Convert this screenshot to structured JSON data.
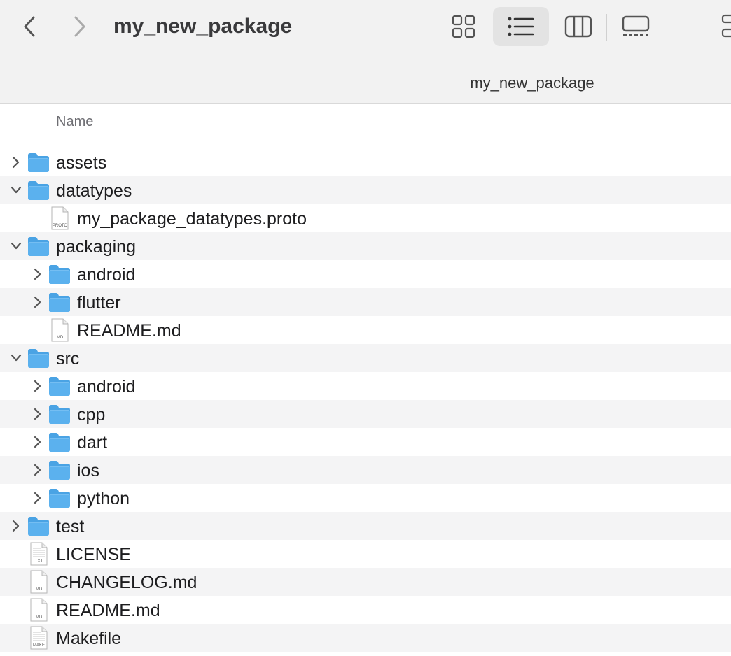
{
  "window": {
    "title": "my_new_package",
    "path_label": "my_new_package"
  },
  "toolbar": {
    "back_icon": "chevron-left-icon",
    "forward_icon": "chevron-right-icon",
    "views": [
      {
        "name": "icon-view",
        "icon": "grid-icon",
        "active": false
      },
      {
        "name": "list-view",
        "icon": "list-icon",
        "active": true
      },
      {
        "name": "column-view",
        "icon": "columns-icon",
        "active": false
      },
      {
        "name": "gallery-view",
        "icon": "gallery-icon",
        "active": false
      }
    ]
  },
  "columns": {
    "name": "Name"
  },
  "colors": {
    "folder": "#5bb1ee",
    "folder_tab": "#4aa3e4",
    "row_alt": "#f4f4f5",
    "toolbar_bg": "#f2f2f2"
  },
  "files": [
    {
      "name": "assets",
      "kind": "folder",
      "level": 0,
      "expanded": false
    },
    {
      "name": "datatypes",
      "kind": "folder",
      "level": 0,
      "expanded": true
    },
    {
      "name": "my_package_datatypes.proto",
      "kind": "file",
      "tag": "PROTO",
      "level": 1
    },
    {
      "name": "packaging",
      "kind": "folder",
      "level": 0,
      "expanded": true
    },
    {
      "name": "android",
      "kind": "folder",
      "level": 1,
      "expanded": false
    },
    {
      "name": "flutter",
      "kind": "folder",
      "level": 1,
      "expanded": false
    },
    {
      "name": "README.md",
      "kind": "file",
      "tag": "MD",
      "level": 1
    },
    {
      "name": "src",
      "kind": "folder",
      "level": 0,
      "expanded": true
    },
    {
      "name": "android",
      "kind": "folder",
      "level": 1,
      "expanded": false
    },
    {
      "name": "cpp",
      "kind": "folder",
      "level": 1,
      "expanded": false
    },
    {
      "name": "dart",
      "kind": "folder",
      "level": 1,
      "expanded": false
    },
    {
      "name": "ios",
      "kind": "folder",
      "level": 1,
      "expanded": false
    },
    {
      "name": "python",
      "kind": "folder",
      "level": 1,
      "expanded": false
    },
    {
      "name": "test",
      "kind": "folder",
      "level": 0,
      "expanded": false
    },
    {
      "name": "LICENSE",
      "kind": "file",
      "tag": "TXT",
      "level": 0
    },
    {
      "name": "CHANGELOG.md",
      "kind": "file",
      "tag": "MD",
      "level": 0
    },
    {
      "name": "README.md",
      "kind": "file",
      "tag": "MD",
      "level": 0
    },
    {
      "name": "Makefile",
      "kind": "file",
      "tag": "MAKE",
      "level": 0
    }
  ]
}
